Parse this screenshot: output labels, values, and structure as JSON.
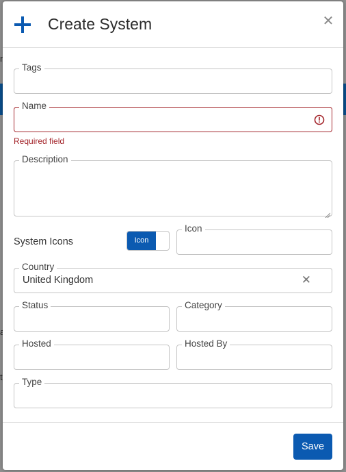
{
  "dialog": {
    "title": "Create System",
    "add_icon": "plus-icon",
    "close_icon": "close-icon",
    "accent_color": "#0b5ab1",
    "error_color": "#a4262c"
  },
  "fields": {
    "tags": {
      "label": "Tags",
      "value": ""
    },
    "name": {
      "label": "Name",
      "value": "",
      "error": "Required field"
    },
    "description": {
      "label": "Description",
      "value": ""
    },
    "system_icons": {
      "label": "System Icons",
      "toggle_label": "Icon"
    },
    "icon": {
      "label": "Icon",
      "value": ""
    },
    "country": {
      "label": "Country",
      "value": "United Kingdom"
    },
    "status": {
      "label": "Status",
      "value": ""
    },
    "category": {
      "label": "Category",
      "value": ""
    },
    "hosted": {
      "label": "Hosted",
      "value": ""
    },
    "hosted_by": {
      "label": "Hosted By",
      "value": ""
    },
    "type": {
      "label": "Type",
      "value": ""
    }
  },
  "actions": {
    "save_label": "Save"
  },
  "background": {
    "frag_1": "n",
    "frag_2": "a",
    "frag_3": "t"
  }
}
